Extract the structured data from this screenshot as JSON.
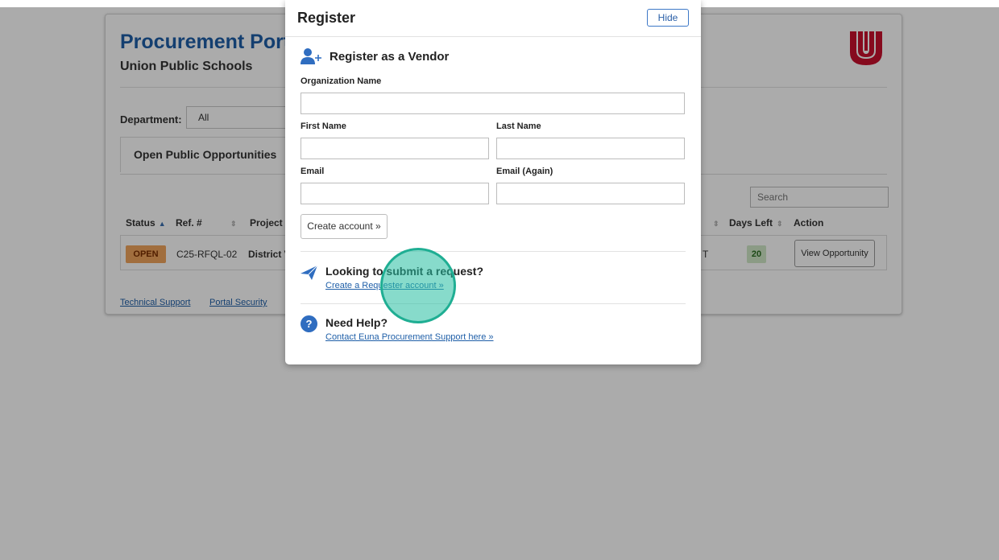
{
  "portal": {
    "title": "Procurement Portal",
    "subtitle": "Union Public Schools"
  },
  "filters": {
    "department_label": "Department:",
    "department_value": "All"
  },
  "tabs": {
    "active_label": "Open Public Opportunities"
  },
  "search": {
    "placeholder": "Search"
  },
  "table": {
    "columns": {
      "status": "Status",
      "ref": "Ref. #",
      "project": "Project",
      "days_left": "Days Left",
      "action": "Action"
    },
    "rows": [
      {
        "status": "OPEN",
        "ref": "C25-RFQL-02",
        "project": "District V",
        "time_fragment": "T",
        "days_left": "20",
        "action": "View Opportunity"
      }
    ]
  },
  "footer": {
    "technical_support": "Technical Support",
    "portal_security": "Portal Security"
  },
  "modal": {
    "title": "Register",
    "hide_label": "Hide",
    "vendor_heading": "Register as a Vendor",
    "fields": {
      "organization": "Organization Name",
      "first_name": "First Name",
      "last_name": "Last Name",
      "email": "Email",
      "email_again": "Email (Again)"
    },
    "create_account_label": "Create account »",
    "requester": {
      "heading": "Looking to submit a request?",
      "link": "Create a Requester account »"
    },
    "help": {
      "heading": "Need Help?",
      "link": "Contact Euna Procurement Support here »"
    }
  },
  "colors": {
    "brand_blue": "#1f5fa8",
    "logo_red": "#c8102e",
    "open_badge": "#f0a45d",
    "days_badge": "#cfe8c7",
    "click_ring": "#1fae93"
  },
  "icons": {
    "add_user": "add-user-icon",
    "paper_plane": "paper-plane-icon",
    "help": "help-icon",
    "logo": "union-logo"
  }
}
